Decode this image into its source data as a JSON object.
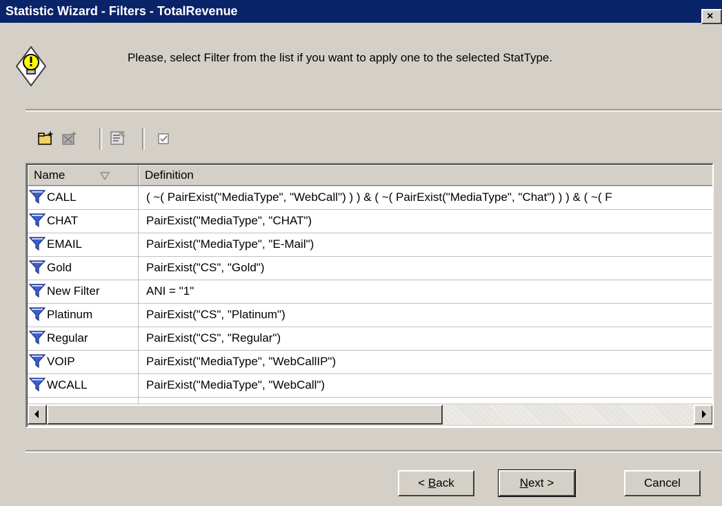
{
  "window": {
    "title": "Statistic Wizard - Filters - TotalRevenue",
    "close_glyph": "×"
  },
  "instruction": "Please, select Filter from the list if you want to apply one to the selected StatType.",
  "toolbar": {
    "icons": [
      "new-filter-icon",
      "delete-filter-icon",
      "properties-icon",
      "checkbox-icon"
    ]
  },
  "table": {
    "columns": [
      "Name",
      "Definition"
    ],
    "rows": [
      {
        "name": "CALL",
        "definition": "( ~( PairExist(\"MediaType\", \"WebCall\") ) ) & ( ~( PairExist(\"MediaType\", \"Chat\") ) ) & ( ~( F"
      },
      {
        "name": "CHAT",
        "definition": "PairExist(\"MediaType\", \"CHAT\")"
      },
      {
        "name": "EMAIL",
        "definition": "PairExist(\"MediaType\", \"E-Mail\")"
      },
      {
        "name": "Gold",
        "definition": "PairExist(\"CS\", \"Gold\")"
      },
      {
        "name": "New Filter",
        "definition": "ANI = \"1\""
      },
      {
        "name": "Platinum",
        "definition": "PairExist(\"CS\", \"Platinum\")"
      },
      {
        "name": "Regular",
        "definition": "PairExist(\"CS\", \"Regular\")"
      },
      {
        "name": "VOIP",
        "definition": "PairExist(\"MediaType\", \"WebCallIP\")"
      },
      {
        "name": "WCALL",
        "definition": "PairExist(\"MediaType\", \"WebCall\")"
      }
    ]
  },
  "buttons": {
    "back": {
      "prefix": "< ",
      "mnemonic": "B",
      "rest": "ack"
    },
    "next": {
      "mnemonic": "N",
      "rest": "ext >"
    },
    "cancel": "Cancel"
  },
  "colors": {
    "titlebar": "#0a246a",
    "face": "#d4d0c8",
    "filter_icon": "#3a5fd0"
  }
}
